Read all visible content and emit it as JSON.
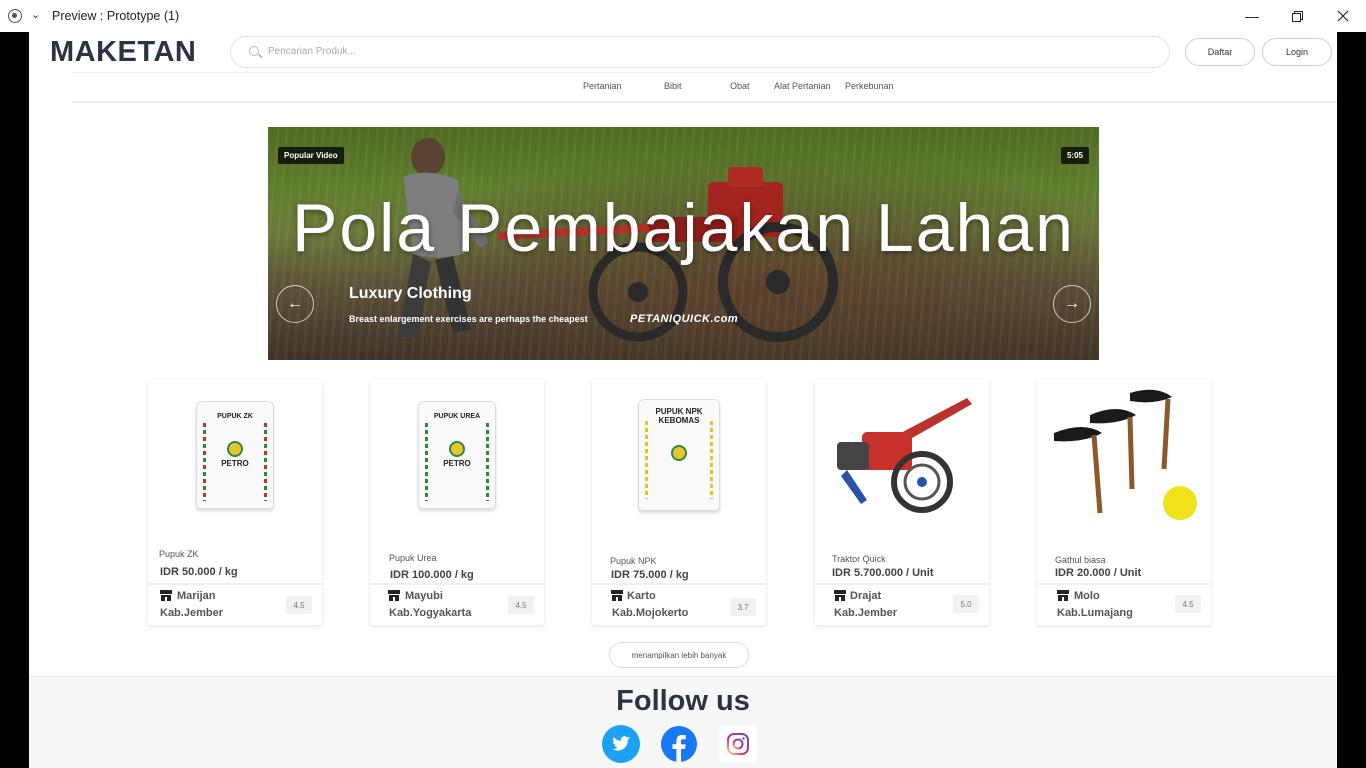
{
  "window": {
    "title": "Preview : Prototype (1)"
  },
  "header": {
    "logo": "MAKETAN",
    "search_placeholder": "Pencarian Produk...",
    "register_label": "Daftar",
    "login_label": "Login"
  },
  "nav": [
    "Pertanian",
    "Bibit",
    "Obat",
    "Alat Pertanian",
    "Perkebunan"
  ],
  "banner": {
    "badge": "Popular Video",
    "duration": "5:05",
    "title": "Pola Pembajakan Lahan",
    "subtitle": "Luxury Clothing",
    "description": "Breast enlargement exercises are perhaps the cheapest",
    "brand": "PETANIQUICK.com"
  },
  "products": [
    {
      "name": "Pupuk ZK",
      "price": "IDR 50.000 / kg",
      "seller": "Marijan",
      "location": "Kab.Jember",
      "rating": "4.5",
      "sack_title": "PUPUK ZK",
      "sack_brand": "PETRO",
      "accent": "#c8302b"
    },
    {
      "name": "Pupuk Urea",
      "price": "IDR 100.000 / kg",
      "seller": "Mayubi",
      "location": "Kab.Yogyakarta",
      "rating": "4.5",
      "sack_title": "PUPUK UREA",
      "sack_brand": "PETRO",
      "accent": "#2c8a3a"
    },
    {
      "name": "Pupuk NPK",
      "price": "IDR 75.000 / kg",
      "seller": "Karto",
      "location": "Kab.Mojokerto",
      "rating": "3.7",
      "sack_title": "PUPUK NPK KEBOMAS",
      "sack_brand": "",
      "accent": "#e8c226"
    },
    {
      "name": "Traktor Quick",
      "price": "IDR 5.700.000 / Unit",
      "seller": "Drajat",
      "location": "Kab.Jember",
      "rating": "5.0"
    },
    {
      "name": "Gathul biasa",
      "price": "IDR 20.000 / Unit",
      "seller": "Molo",
      "location": "Kab.Lumajang",
      "rating": "4.5"
    }
  ],
  "more_label": "menampilkan lebih banyak",
  "footer": {
    "follow": "Follow us"
  }
}
